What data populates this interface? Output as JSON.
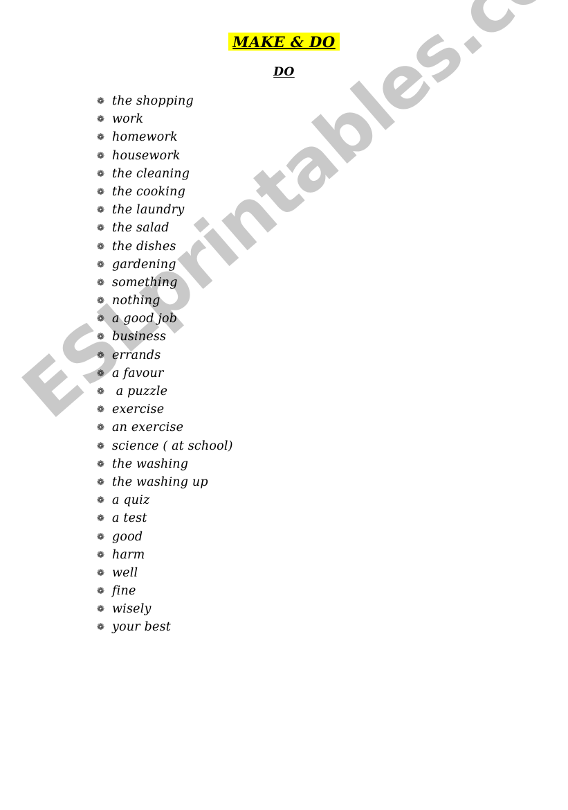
{
  "document": {
    "title": "MAKE & DO",
    "subtitle": "DO",
    "title_highlight_color": "#ffff00",
    "text_color": "#000000",
    "page_background": "#ffffff"
  },
  "watermark": {
    "text": "ESLprintables.com",
    "color": "#c9c9c9"
  },
  "list": {
    "bullet_glyph": "❁",
    "items": [
      {
        "label": "the shopping"
      },
      {
        "label": "work"
      },
      {
        "label": "homework"
      },
      {
        "label": "housework"
      },
      {
        "label": "the cleaning"
      },
      {
        "label": "the cooking"
      },
      {
        "label": "the laundry"
      },
      {
        "label": "the salad"
      },
      {
        "label": "the dishes"
      },
      {
        "label": "gardening"
      },
      {
        "label": "something"
      },
      {
        "label": "nothing"
      },
      {
        "label": "a good job"
      },
      {
        "label": "business"
      },
      {
        "label": "errands"
      },
      {
        "label": "a favour"
      },
      {
        "label": " a puzzle"
      },
      {
        "label": "exercise"
      },
      {
        "label": "an exercise"
      },
      {
        "label": "science ( at school)"
      },
      {
        "label": "the washing"
      },
      {
        "label": "the washing up"
      },
      {
        "label": "a quiz"
      },
      {
        "label": "a test"
      },
      {
        "label": "good"
      },
      {
        "label": "harm"
      },
      {
        "label": "well"
      },
      {
        "label": "fine"
      },
      {
        "label": "wisely"
      },
      {
        "label": "your best"
      }
    ]
  }
}
